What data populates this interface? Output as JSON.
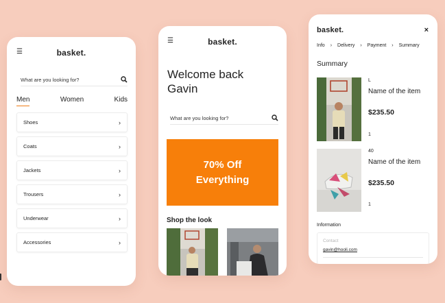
{
  "screen1": {
    "brand": "basket.",
    "search_placeholder": "What are you looking for?",
    "tabs": [
      "Men",
      "Women",
      "Kids"
    ],
    "categories": [
      "Shoes",
      "Coats",
      "Jackets",
      "Trousers",
      "Underwear",
      "Accessories"
    ]
  },
  "screen2": {
    "brand": "basket.",
    "welcome_line1": "Welcome back",
    "welcome_line2": "Gavin",
    "search_placeholder": "What are you looking for?",
    "promo_line1": "70% Off",
    "promo_line2": "Everything",
    "shop_title": "Shop the look"
  },
  "screen3": {
    "brand": "basket.",
    "close": "×",
    "breadcrumb": [
      "Info",
      "Delivery",
      "Payment",
      "Summary"
    ],
    "summary_title": "Summary",
    "items": [
      {
        "size": "L",
        "name": "Name of the item",
        "price": "$235.50",
        "qty": "1"
      },
      {
        "size": "40",
        "name": "Name of the item",
        "price": "$235.50",
        "qty": "1"
      }
    ],
    "information_label": "Information",
    "contact_label": "Contact",
    "contact_value": "gavin@hooli.com"
  },
  "colors": {
    "background": "#f7cdbd",
    "accent": "#f77f0a"
  },
  "icons": {
    "menu": "hamburger-icon",
    "search": "search-icon",
    "chevron": "chevron-right-icon",
    "close": "close-icon"
  }
}
